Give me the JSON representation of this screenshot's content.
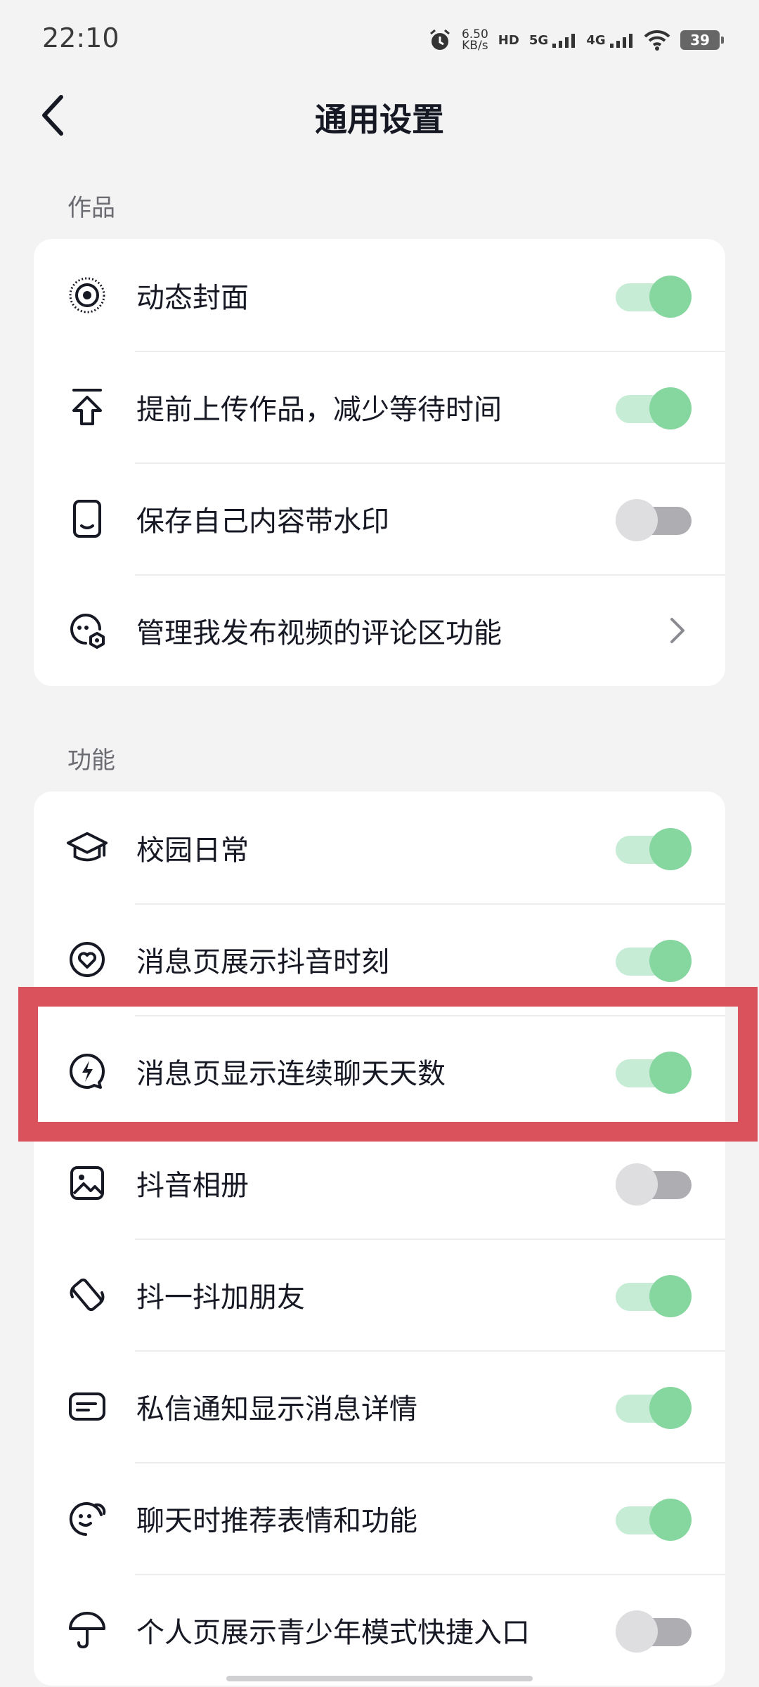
{
  "status_bar": {
    "time": "22:10",
    "net_speed_value": "6.50",
    "net_speed_unit": "KB/s",
    "hd_label": "HD",
    "sig1_label": "5G",
    "sig2_label": "4G",
    "battery": "39"
  },
  "header": {
    "title": "通用设置"
  },
  "sections": {
    "works": {
      "title": "作品",
      "items": [
        {
          "label": "动态封面",
          "icon": "live-cover-icon",
          "control": "toggle",
          "on": true
        },
        {
          "label": "提前上传作品，减少等待时间",
          "icon": "upload-icon",
          "control": "toggle",
          "on": true
        },
        {
          "label": "保存自己内容带水印",
          "icon": "phone-watermark-icon",
          "control": "toggle",
          "on": false
        },
        {
          "label": "管理我发布视频的评论区功能",
          "icon": "comment-settings-icon",
          "control": "chevron"
        }
      ]
    },
    "features": {
      "title": "功能",
      "items": [
        {
          "label": "校园日常",
          "icon": "graduation-cap-icon",
          "control": "toggle",
          "on": true
        },
        {
          "label": "消息页展示抖音时刻",
          "icon": "heart-circle-icon",
          "control": "toggle",
          "on": true
        },
        {
          "label": "消息页显示连续聊天天数",
          "icon": "lightning-bubble-icon",
          "control": "toggle",
          "on": true
        },
        {
          "label": "抖音相册",
          "icon": "album-icon",
          "control": "toggle",
          "on": false
        },
        {
          "label": "抖一抖加朋友",
          "icon": "shake-phone-icon",
          "control": "toggle",
          "on": true
        },
        {
          "label": "私信通知显示消息详情",
          "icon": "message-card-icon",
          "control": "toggle",
          "on": true
        },
        {
          "label": "聊天时推荐表情和功能",
          "icon": "smile-bubble-icon",
          "control": "toggle",
          "on": true
        },
        {
          "label": "个人页展示青少年模式快捷入口",
          "icon": "umbrella-icon",
          "control": "toggle",
          "on": false
        }
      ]
    }
  },
  "colors": {
    "toggle_on_track": "#c7ecd6",
    "toggle_on_knob": "#86d6a0",
    "toggle_off_track": "#aeadb2",
    "toggle_off_knob": "#dedee0",
    "highlight": "#d9525c"
  }
}
